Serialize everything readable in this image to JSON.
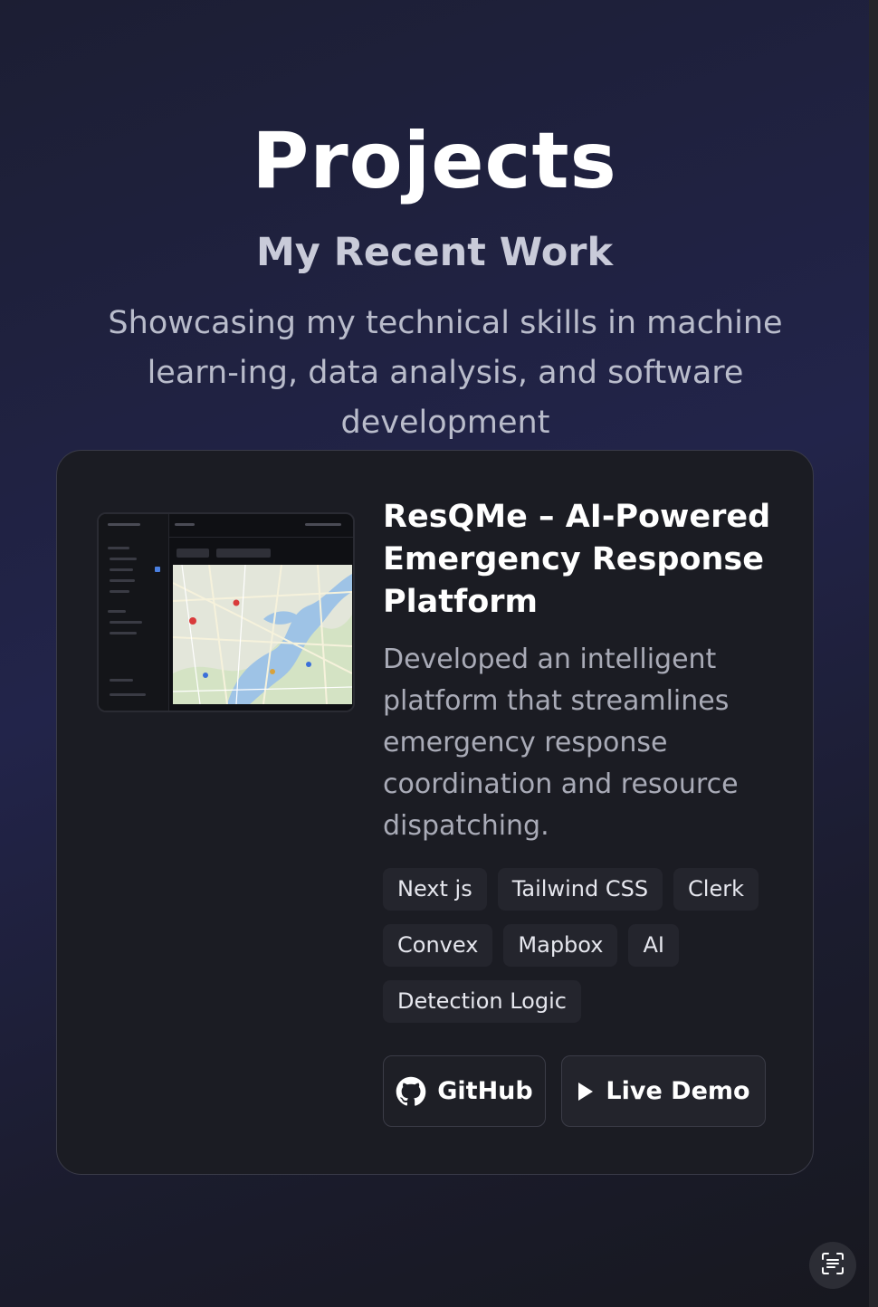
{
  "header": {
    "title": "Projects",
    "subtitle": "My Recent Work",
    "description": "Showcasing my technical skills in machine learn-ing, data analysis, and software development"
  },
  "project": {
    "title": "ResQMe – AI-Powered Emergency Response Platform",
    "description": "Developed an intelligent platform that streamlines emergency response coordination and resource dispatching.",
    "tags": [
      "Next js",
      "Tailwind CSS",
      "Clerk",
      "Convex",
      "Mapbox",
      "AI",
      "Detection Logic"
    ],
    "github_label": "GitHub",
    "demo_label": "Live Demo"
  },
  "icons": {
    "github": "github-icon",
    "play": "play-icon",
    "fab": "scan-text-icon"
  },
  "colors": {
    "background": "#1c1e33",
    "card": "#1b1c23",
    "tag": "#24252d",
    "text_muted": "#a9abb7"
  }
}
